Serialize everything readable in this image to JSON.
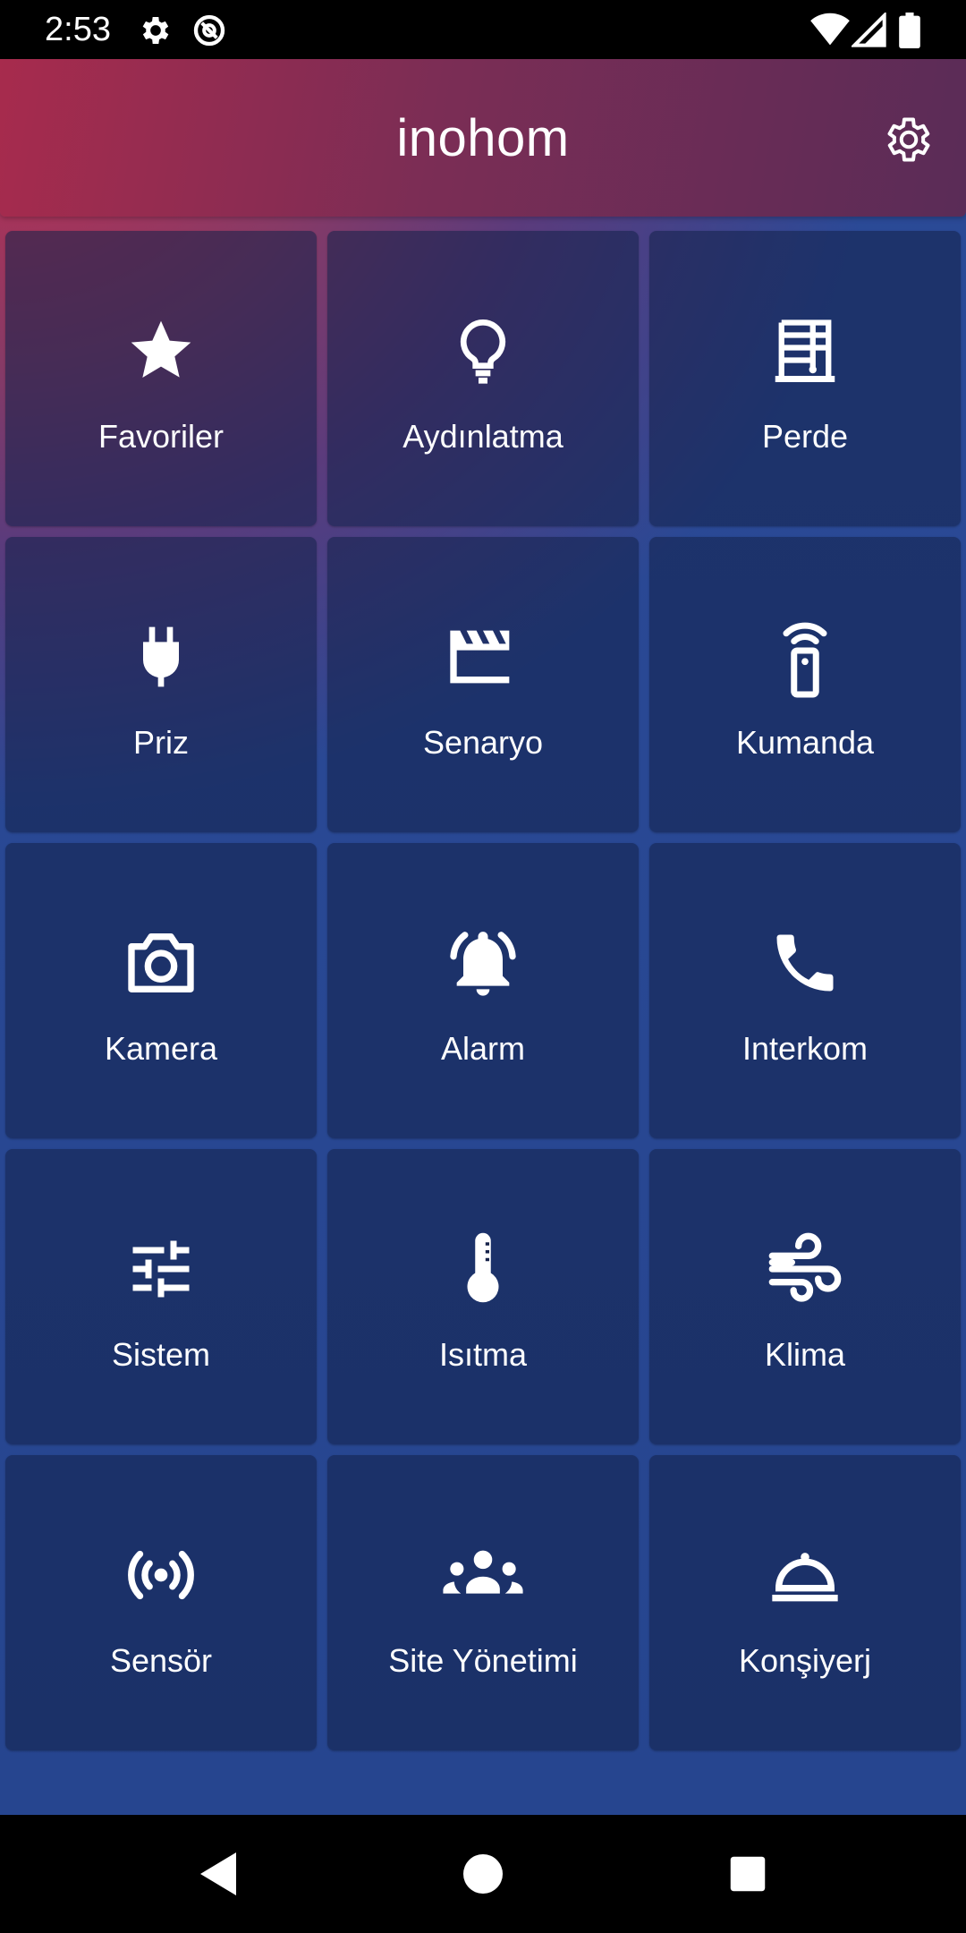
{
  "status_bar": {
    "time": "2:53",
    "left_icons": [
      "gear-icon",
      "at-sign-icon"
    ],
    "right_icons": [
      "wifi-icon",
      "cellular-signal-icon",
      "battery-icon"
    ]
  },
  "header": {
    "title": "inohom",
    "settings_icon": "gear-icon"
  },
  "tiles": [
    {
      "label": "Favoriler",
      "icon": "star-icon"
    },
    {
      "label": "Aydınlatma",
      "icon": "lightbulb-icon"
    },
    {
      "label": "Perde",
      "icon": "curtain-icon"
    },
    {
      "label": "Priz",
      "icon": "plug-icon"
    },
    {
      "label": "Senaryo",
      "icon": "clapperboard-icon"
    },
    {
      "label": "Kumanda",
      "icon": "remote-control-icon"
    },
    {
      "label": "Kamera",
      "icon": "camera-icon"
    },
    {
      "label": "Alarm",
      "icon": "alarm-bell-icon"
    },
    {
      "label": "Interkom",
      "icon": "phone-icon"
    },
    {
      "label": "Sistem",
      "icon": "sliders-icon"
    },
    {
      "label": "Isıtma",
      "icon": "thermometer-icon"
    },
    {
      "label": "Klima",
      "icon": "wind-icon"
    },
    {
      "label": "Sensör",
      "icon": "sensor-signal-icon"
    },
    {
      "label": "Site Yönetimi",
      "icon": "group-icon"
    },
    {
      "label": "Konşiyerj",
      "icon": "room-service-bell-icon"
    }
  ],
  "nav_bar": {
    "icons": [
      "back-triangle-icon",
      "home-circle-icon",
      "recents-square-icon"
    ]
  },
  "colors": {
    "header_start": "#a72b4d",
    "header_end": "#5a2c57",
    "background_top": "#ba3052",
    "background_bottom": "#26458f",
    "tile_overlay": "rgba(18,32,72,0.55)",
    "text": "#ffffff"
  }
}
